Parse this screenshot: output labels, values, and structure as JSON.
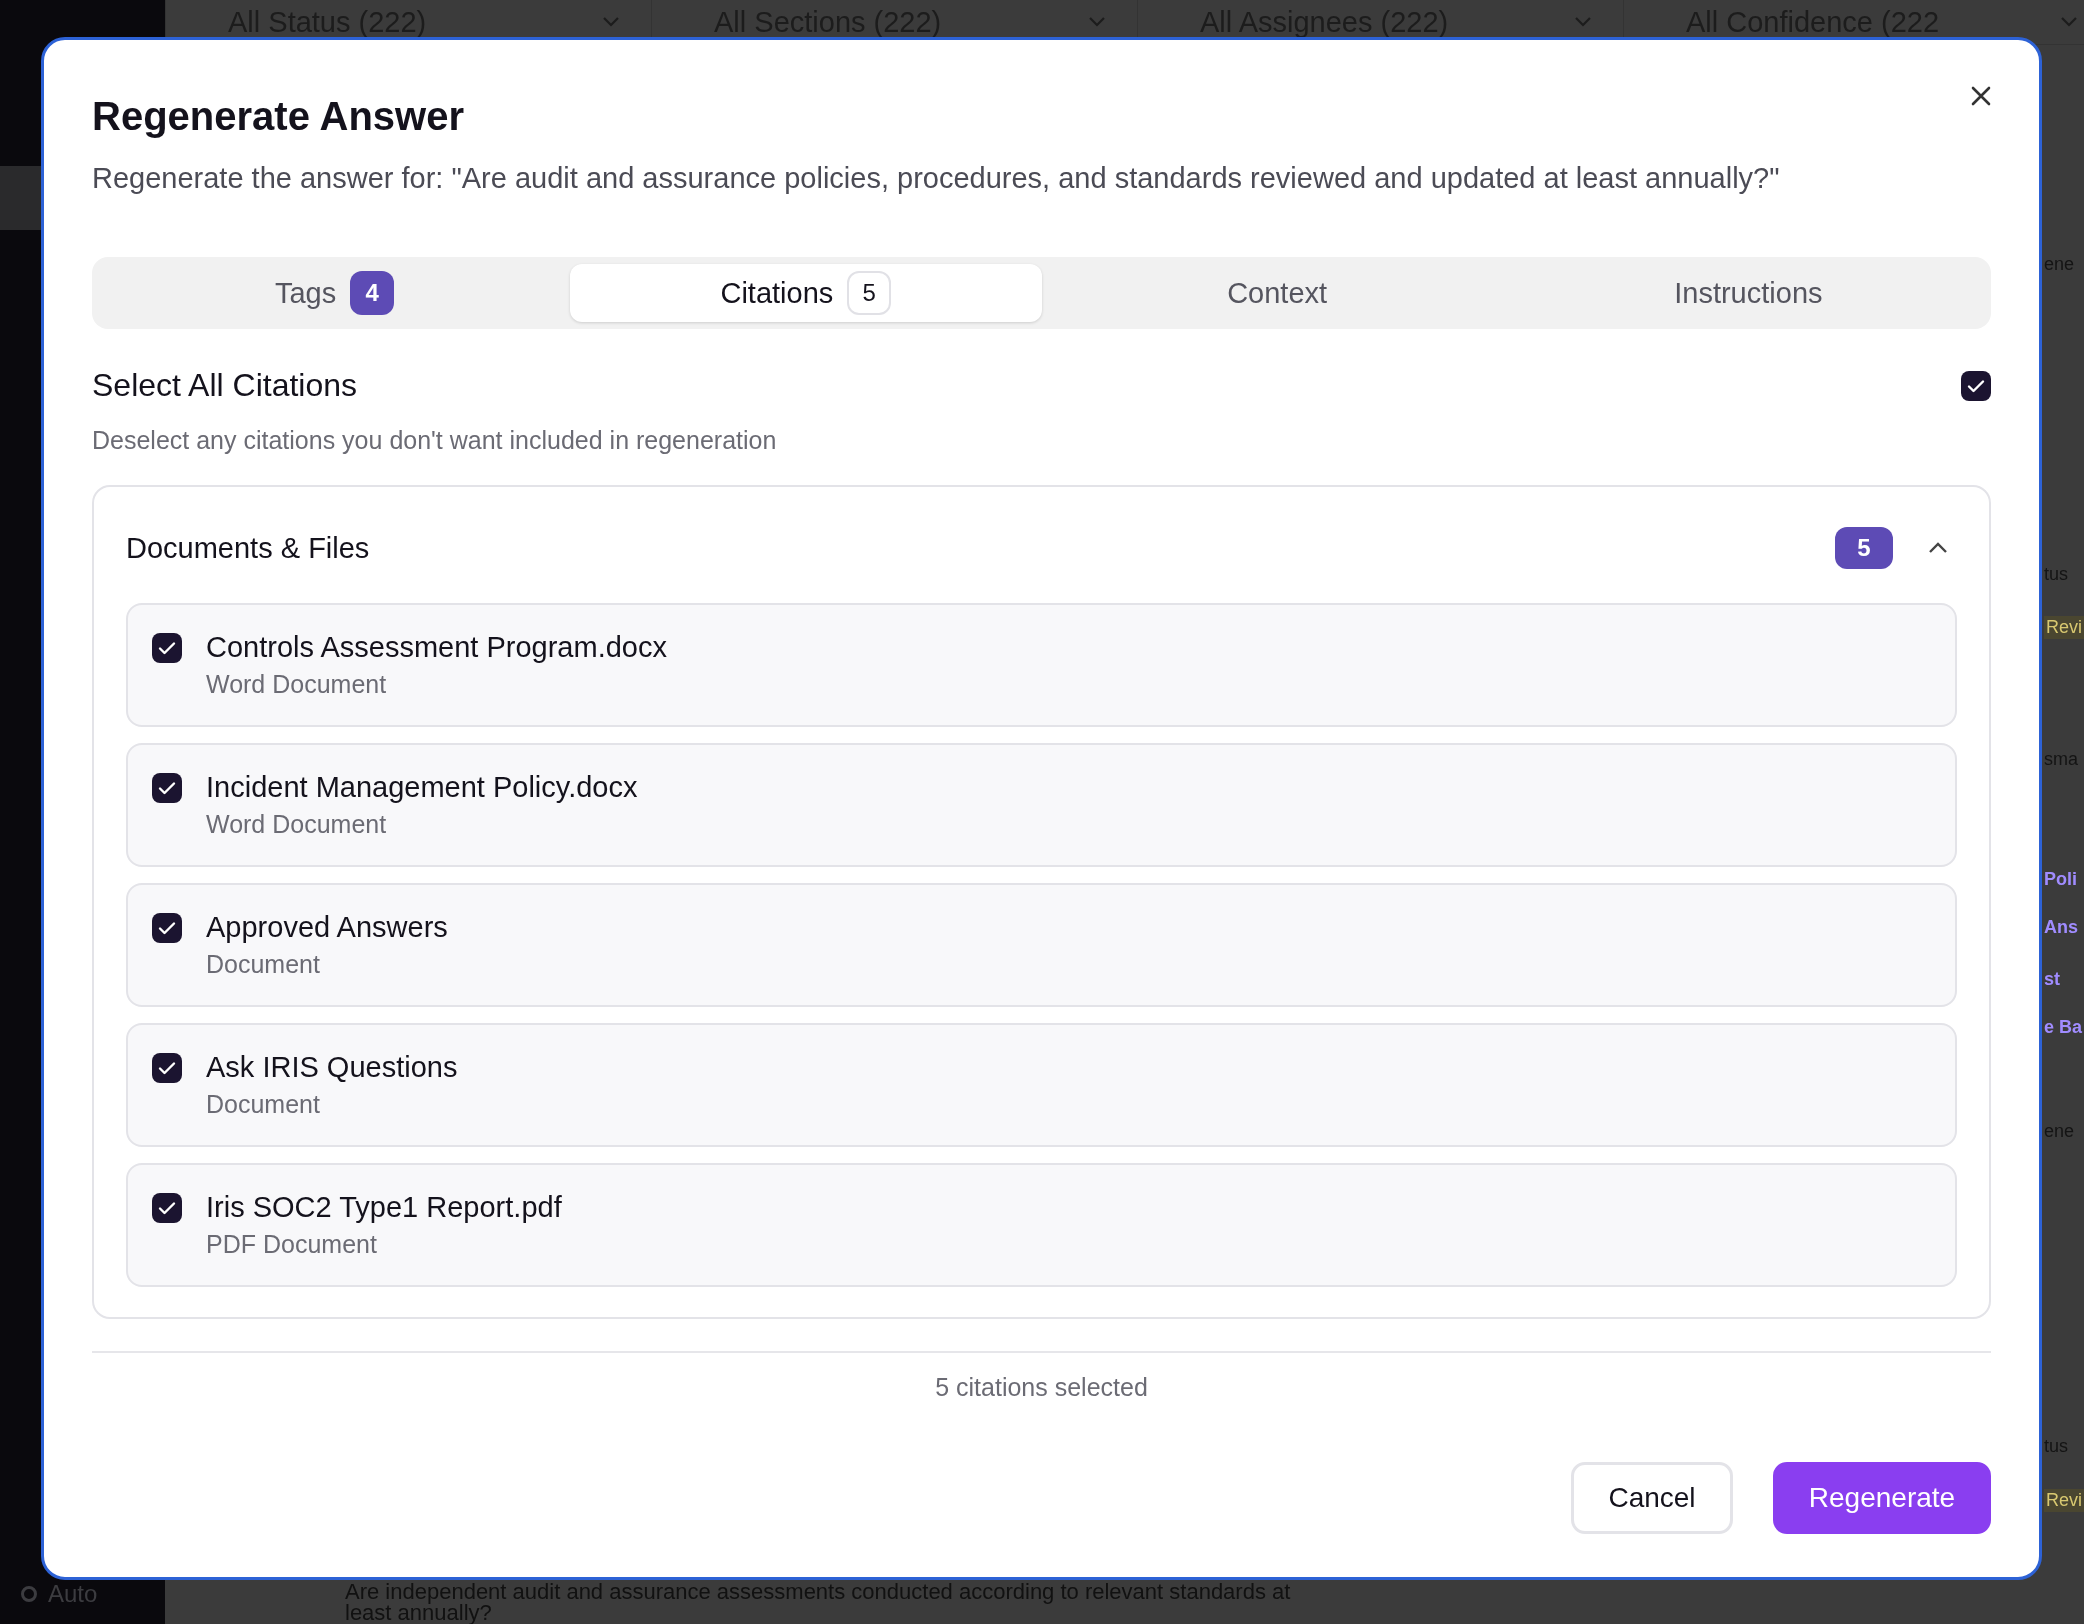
{
  "background": {
    "filters": [
      {
        "label": "All Status (222)"
      },
      {
        "label": "All Sections (222)"
      },
      {
        "label": "All Assignees (222)"
      },
      {
        "label": "All Confidence (222"
      }
    ],
    "side_fragments": [
      {
        "text": "ene",
        "kind": "plain"
      },
      {
        "text": "tus",
        "kind": "plain"
      },
      {
        "text": "Revi",
        "kind": "badge"
      },
      {
        "text": "sma",
        "kind": "plain"
      },
      {
        "text": "Poli",
        "kind": "link"
      },
      {
        "text": "Ans",
        "kind": "link"
      },
      {
        "text": "st",
        "kind": "link"
      },
      {
        "text": "e Ba",
        "kind": "link"
      },
      {
        "text": "ene",
        "kind": "plain"
      },
      {
        "text": "tus",
        "kind": "plain"
      },
      {
        "text": "Revi",
        "kind": "badge"
      }
    ],
    "sidebar_mode": "Auto",
    "question_lines": [
      "Are independent audit and assurance assessments conducted according to relevant standards at",
      "least annually?"
    ]
  },
  "dialog": {
    "title": "Regenerate Answer",
    "subtitle": "Regenerate the answer for: \"Are audit and assurance policies, procedures, and standards reviewed and updated at least annually?\"",
    "tabs": [
      {
        "label": "Tags",
        "count": "4",
        "selected": false
      },
      {
        "label": "Citations",
        "count": "5",
        "selected": true
      },
      {
        "label": "Context",
        "selected": false
      },
      {
        "label": "Instructions",
        "selected": false
      }
    ],
    "select_all": {
      "label": "Select All Citations",
      "description": "Deselect any citations you don't want included in regeneration",
      "checked": true
    },
    "group": {
      "title": "Documents & Files",
      "count": "5",
      "expanded": true,
      "items": [
        {
          "name": "Controls Assessment Program.docx",
          "type": "Word Document",
          "checked": true
        },
        {
          "name": "Incident Management Policy.docx",
          "type": "Word Document",
          "checked": true
        },
        {
          "name": "Approved Answers",
          "type": "Document",
          "checked": true
        },
        {
          "name": "Ask IRIS Questions",
          "type": "Document",
          "checked": true
        },
        {
          "name": "Iris SOC2 Type1 Report.pdf",
          "type": "PDF Document",
          "checked": true
        }
      ]
    },
    "footer_note": "5 citations selected",
    "buttons": [
      {
        "label": "Cancel",
        "kind": "secondary"
      },
      {
        "label": "Regenerate",
        "kind": "primary"
      }
    ]
  }
}
